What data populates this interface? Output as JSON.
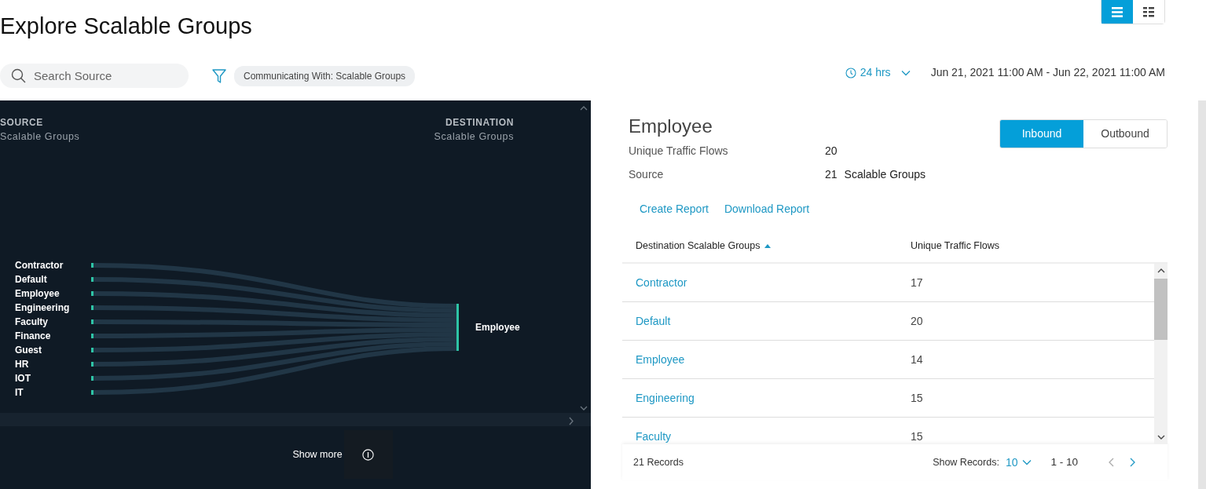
{
  "page": {
    "title": "Explore Scalable Groups"
  },
  "view_toggle": [
    {
      "kind": "list",
      "selected": true
    },
    {
      "kind": "grid",
      "selected": false
    }
  ],
  "search": {
    "placeholder": "Search Source"
  },
  "filter_chip": "Communicating With: Scalable Groups",
  "time_range": {
    "label": "24 hrs",
    "range": "Jun 21, 2021 11:00 AM - Jun 22, 2021 11:00 AM"
  },
  "diagram": {
    "source_heading": "SOURCE",
    "source_sub": "Scalable Groups",
    "destination_heading": "DESTINATION",
    "destination_sub": "Scalable Groups",
    "sources": [
      "Contractor",
      "Default",
      "Employee",
      "Engineering",
      "Faculty",
      "Finance",
      "Guest",
      "HR",
      "IOT",
      "IT"
    ],
    "destination": "Employee",
    "show_more": "Show more"
  },
  "details": {
    "title": "Employee",
    "direction_tabs": [
      {
        "label": "Inbound",
        "selected": true
      },
      {
        "label": "Outbound",
        "selected": false
      }
    ],
    "stats": [
      {
        "label": "Unique Traffic Flows",
        "value": "20"
      },
      {
        "label": "Source",
        "value": "21",
        "unit": "Scalable Groups"
      }
    ],
    "actions": [
      "Create Report",
      "Download Report"
    ],
    "table": {
      "columns": [
        {
          "label": "Destination Scalable Groups",
          "sorted": true
        },
        {
          "label": "Unique Traffic Flows",
          "sorted": false
        }
      ],
      "rows": [
        [
          "Contractor",
          "17"
        ],
        [
          "Default",
          "20"
        ],
        [
          "Employee",
          "14"
        ],
        [
          "Engineering",
          "15"
        ],
        [
          "Faculty",
          "15"
        ]
      ]
    },
    "footer": {
      "records": "21 Records",
      "show_records_label": "Show Records:",
      "page_size": "10",
      "range": "1 - 10"
    }
  }
}
